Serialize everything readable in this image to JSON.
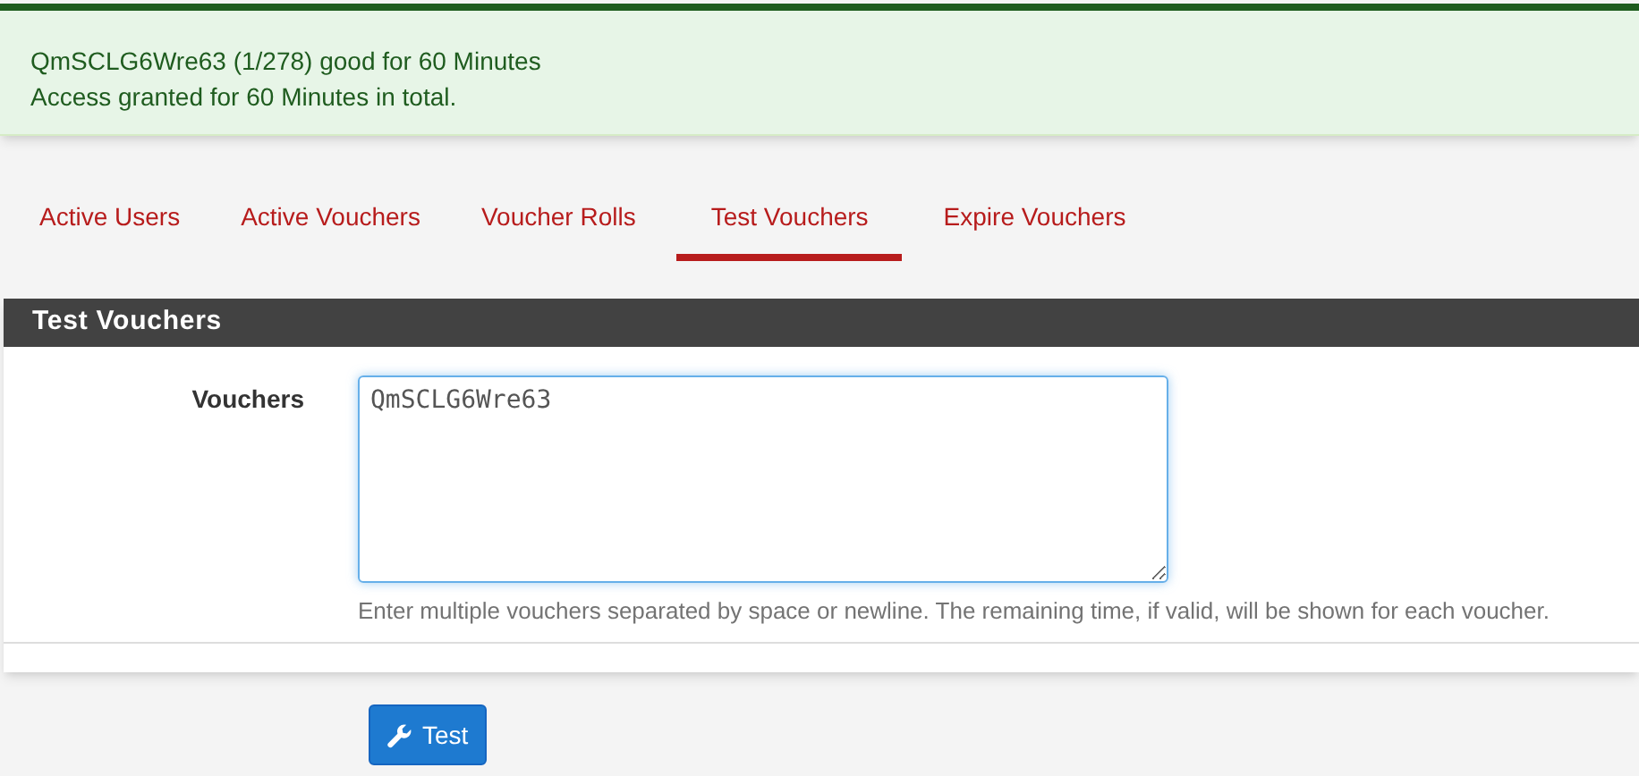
{
  "alert": {
    "lines": [
      "QmSCLG6Wre63 (1/278) good for 60 Minutes",
      "Access granted for 60 Minutes in total."
    ]
  },
  "tabs": [
    {
      "label": "Active Users",
      "selected": false
    },
    {
      "label": "Active Vouchers",
      "selected": false
    },
    {
      "label": "Voucher Rolls",
      "selected": false
    },
    {
      "label": "Test Vouchers",
      "selected": true
    },
    {
      "label": "Expire Vouchers",
      "selected": false
    }
  ],
  "panel": {
    "title": "Test Vouchers",
    "field": {
      "label": "Vouchers",
      "value": "QmSCLG6Wre63",
      "help": "Enter multiple vouchers separated by space or newline. The remaining time, if valid, will be shown for each voucher."
    }
  },
  "button": {
    "label": "Test"
  }
}
